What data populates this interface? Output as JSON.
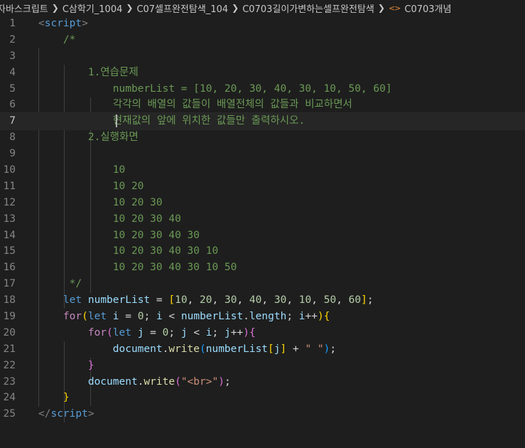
{
  "breadcrumb": {
    "items": [
      "자바스크립트",
      "C삼학기_1004",
      "C07셀프완전탐색_104",
      "C0703길이가변하는셀프완전탐색"
    ],
    "file_label": "C0703개념",
    "file_icon": "code-bracket-icon"
  },
  "editor": {
    "current_line": 7,
    "lines": [
      {
        "n": "1",
        "tokens": [
          [
            "t-punc",
            "<"
          ],
          [
            "t-tag",
            "script"
          ],
          [
            "t-punc",
            ">"
          ]
        ]
      },
      {
        "n": "2",
        "tokens": [
          [
            "",
            "    "
          ],
          [
            "t-com",
            "/*"
          ]
        ]
      },
      {
        "n": "3",
        "tokens": [
          [
            "",
            ""
          ]
        ]
      },
      {
        "n": "4",
        "tokens": [
          [
            "",
            "        "
          ],
          [
            "t-com",
            "1.연습문제"
          ]
        ]
      },
      {
        "n": "5",
        "tokens": [
          [
            "",
            "            "
          ],
          [
            "t-com",
            "numberList = [10, 20, 30, 40, 30, 10, 50, 60]"
          ]
        ]
      },
      {
        "n": "6",
        "tokens": [
          [
            "",
            "            "
          ],
          [
            "t-com",
            "각각의 배열의 값들이 배열전체의 값들과 비교하면서"
          ]
        ]
      },
      {
        "n": "7",
        "tokens": [
          [
            "",
            "            "
          ],
          [
            "t-com",
            "현재값의 앞에 위치한 값들만 출력하시오."
          ]
        ]
      },
      {
        "n": "8",
        "tokens": [
          [
            "",
            "        "
          ],
          [
            "t-com",
            "2.실행화면"
          ]
        ]
      },
      {
        "n": "9",
        "tokens": [
          [
            "",
            ""
          ]
        ]
      },
      {
        "n": "10",
        "tokens": [
          [
            "",
            "            "
          ],
          [
            "t-com",
            "10"
          ]
        ]
      },
      {
        "n": "11",
        "tokens": [
          [
            "",
            "            "
          ],
          [
            "t-com",
            "10 20"
          ]
        ]
      },
      {
        "n": "12",
        "tokens": [
          [
            "",
            "            "
          ],
          [
            "t-com",
            "10 20 30"
          ]
        ]
      },
      {
        "n": "13",
        "tokens": [
          [
            "",
            "            "
          ],
          [
            "t-com",
            "10 20 30 40"
          ]
        ]
      },
      {
        "n": "14",
        "tokens": [
          [
            "",
            "            "
          ],
          [
            "t-com",
            "10 20 30 40 30"
          ]
        ]
      },
      {
        "n": "15",
        "tokens": [
          [
            "",
            "            "
          ],
          [
            "t-com",
            "10 20 30 40 30 10"
          ]
        ]
      },
      {
        "n": "16",
        "tokens": [
          [
            "",
            "            "
          ],
          [
            "t-com",
            "10 20 30 40 30 10 50"
          ]
        ]
      },
      {
        "n": "17",
        "tokens": [
          [
            "",
            "     "
          ],
          [
            "t-com",
            "*/"
          ]
        ]
      },
      {
        "n": "18",
        "tokens": [
          [
            "",
            "    "
          ],
          [
            "t-kw",
            "let"
          ],
          [
            "t-op",
            " "
          ],
          [
            "t-var",
            "numberList"
          ],
          [
            "t-op",
            " = "
          ],
          [
            "t-b1",
            "["
          ],
          [
            "t-num",
            "10"
          ],
          [
            "t-op",
            ", "
          ],
          [
            "t-num",
            "20"
          ],
          [
            "t-op",
            ", "
          ],
          [
            "t-num",
            "30"
          ],
          [
            "t-op",
            ", "
          ],
          [
            "t-num",
            "40"
          ],
          [
            "t-op",
            ", "
          ],
          [
            "t-num",
            "30"
          ],
          [
            "t-op",
            ", "
          ],
          [
            "t-num",
            "10"
          ],
          [
            "t-op",
            ", "
          ],
          [
            "t-num",
            "50"
          ],
          [
            "t-op",
            ", "
          ],
          [
            "t-num",
            "60"
          ],
          [
            "t-b1",
            "]"
          ],
          [
            "t-op",
            ";"
          ]
        ]
      },
      {
        "n": "19",
        "tokens": [
          [
            "",
            "    "
          ],
          [
            "t-ctl",
            "for"
          ],
          [
            "t-b1",
            "("
          ],
          [
            "t-kw",
            "let"
          ],
          [
            "t-op",
            " "
          ],
          [
            "t-var",
            "i"
          ],
          [
            "t-op",
            " = "
          ],
          [
            "t-num",
            "0"
          ],
          [
            "t-op",
            "; "
          ],
          [
            "t-var",
            "i"
          ],
          [
            "t-op",
            " < "
          ],
          [
            "t-var",
            "numberList"
          ],
          [
            "t-op",
            "."
          ],
          [
            "t-var",
            "length"
          ],
          [
            "t-op",
            "; "
          ],
          [
            "t-var",
            "i"
          ],
          [
            "t-op",
            "++"
          ],
          [
            "t-b1",
            ")"
          ],
          [
            "t-b1",
            "{"
          ]
        ]
      },
      {
        "n": "20",
        "tokens": [
          [
            "",
            "        "
          ],
          [
            "t-ctl",
            "for"
          ],
          [
            "t-b2",
            "("
          ],
          [
            "t-kw",
            "let"
          ],
          [
            "t-op",
            " "
          ],
          [
            "t-var",
            "j"
          ],
          [
            "t-op",
            " = "
          ],
          [
            "t-num",
            "0"
          ],
          [
            "t-op",
            "; "
          ],
          [
            "t-var",
            "j"
          ],
          [
            "t-op",
            " < "
          ],
          [
            "t-var",
            "i"
          ],
          [
            "t-op",
            "; "
          ],
          [
            "t-var",
            "j"
          ],
          [
            "t-op",
            "++"
          ],
          [
            "t-b2",
            ")"
          ],
          [
            "t-b2",
            "{"
          ]
        ]
      },
      {
        "n": "21",
        "tokens": [
          [
            "",
            "            "
          ],
          [
            "t-var",
            "document"
          ],
          [
            "t-op",
            "."
          ],
          [
            "t-fn",
            "write"
          ],
          [
            "t-b3",
            "("
          ],
          [
            "t-var",
            "numberList"
          ],
          [
            "t-b1",
            "["
          ],
          [
            "t-var",
            "j"
          ],
          [
            "t-b1",
            "]"
          ],
          [
            "t-op",
            " + "
          ],
          [
            "t-str",
            "\" \""
          ],
          [
            "t-b3",
            ")"
          ],
          [
            "t-op",
            ";"
          ]
        ]
      },
      {
        "n": "22",
        "tokens": [
          [
            "",
            "        "
          ],
          [
            "t-b2",
            "}"
          ]
        ]
      },
      {
        "n": "23",
        "tokens": [
          [
            "",
            "        "
          ],
          [
            "t-var",
            "document"
          ],
          [
            "t-op",
            "."
          ],
          [
            "t-fn",
            "write"
          ],
          [
            "t-b2",
            "("
          ],
          [
            "t-str",
            "\"<br>\""
          ],
          [
            "t-b2",
            ")"
          ],
          [
            "t-op",
            ";"
          ]
        ]
      },
      {
        "n": "24",
        "tokens": [
          [
            "",
            "    "
          ],
          [
            "t-b1",
            "}"
          ]
        ]
      },
      {
        "n": "25",
        "tokens": [
          [
            "t-punc",
            "</"
          ],
          [
            "t-tag",
            "script"
          ],
          [
            "t-punc",
            ">"
          ]
        ]
      }
    ]
  }
}
